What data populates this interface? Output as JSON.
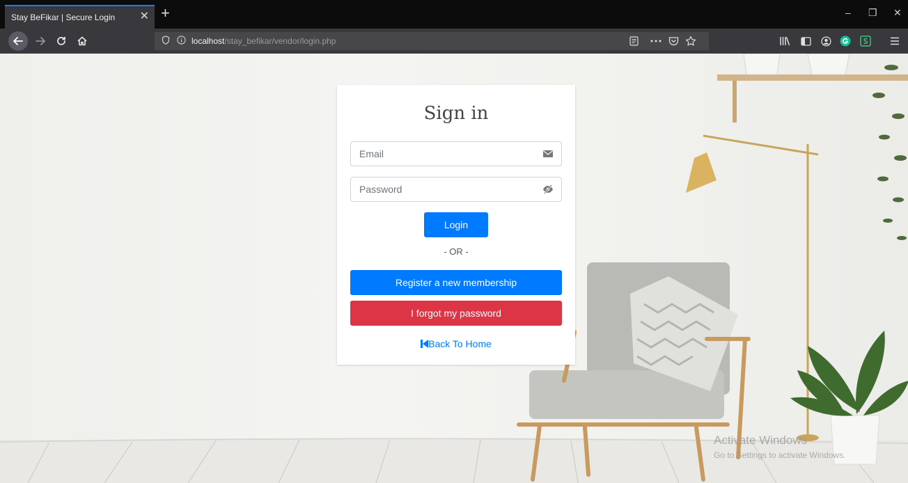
{
  "browser": {
    "tab_title": "Stay BeFikar | Secure Login",
    "tab_close": "✕",
    "new_tab": "+",
    "url_host": "localhost",
    "url_path": "/stay_befikar/vendor/login.php",
    "window_controls": {
      "minimize": "–",
      "restore": "❐",
      "close": "✕"
    },
    "icons": [
      "back-icon",
      "forward-icon",
      "reload-icon",
      "home-icon",
      "shield-icon",
      "info-icon",
      "reader-icon",
      "more-icon",
      "pocket-icon",
      "star-icon",
      "library-icon",
      "sidebar-icon",
      "account-icon",
      "extension-g-icon",
      "extension-s-icon",
      "menu-icon"
    ]
  },
  "login": {
    "title": "Sign in",
    "email_placeholder": "Email",
    "password_placeholder": "Password",
    "login_label": "Login",
    "or_text": "- OR -",
    "register_label": "Register a new membership",
    "forgot_label": "I forgot my password",
    "home_label": "Back To Home"
  },
  "watermark": {
    "line1": "Activate Windows",
    "line2": "Go to Settings to activate Windows."
  },
  "colors": {
    "primary": "#007bff",
    "danger": "#dc3545",
    "chrome_dark": "#0c0c0d",
    "chrome_toolbar": "#38383d",
    "accent_tab": "#0a84ff"
  }
}
